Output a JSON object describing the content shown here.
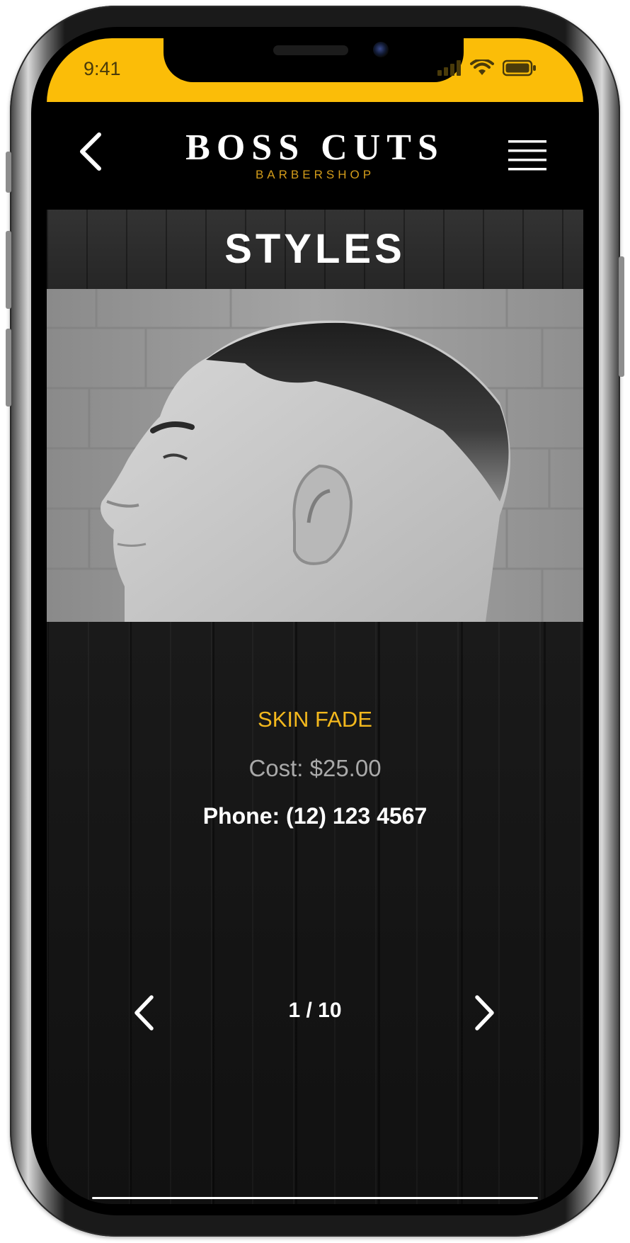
{
  "status_bar": {
    "time": "9:41",
    "background": "#fbbd08",
    "icons": [
      "cellular-signal-icon",
      "wifi-icon",
      "battery-icon"
    ]
  },
  "header": {
    "brand_name": "BOSS CUTS",
    "brand_tagline": "BARBERSHOP",
    "tagline_color": "#d39c1a",
    "back_icon": "chevron-left-icon",
    "menu_icon": "hamburger-menu-icon"
  },
  "page": {
    "title": "STYLES"
  },
  "style": {
    "image_desc": "hairstyle-photo",
    "name": "SKIN FADE",
    "name_color": "#f3b81d",
    "cost": "Cost: $25.00",
    "phone": "Phone: (12) 123 4567"
  },
  "pager": {
    "label": "1 / 10",
    "prev_icon": "chevron-left-icon",
    "next_icon": "chevron-right-icon"
  }
}
